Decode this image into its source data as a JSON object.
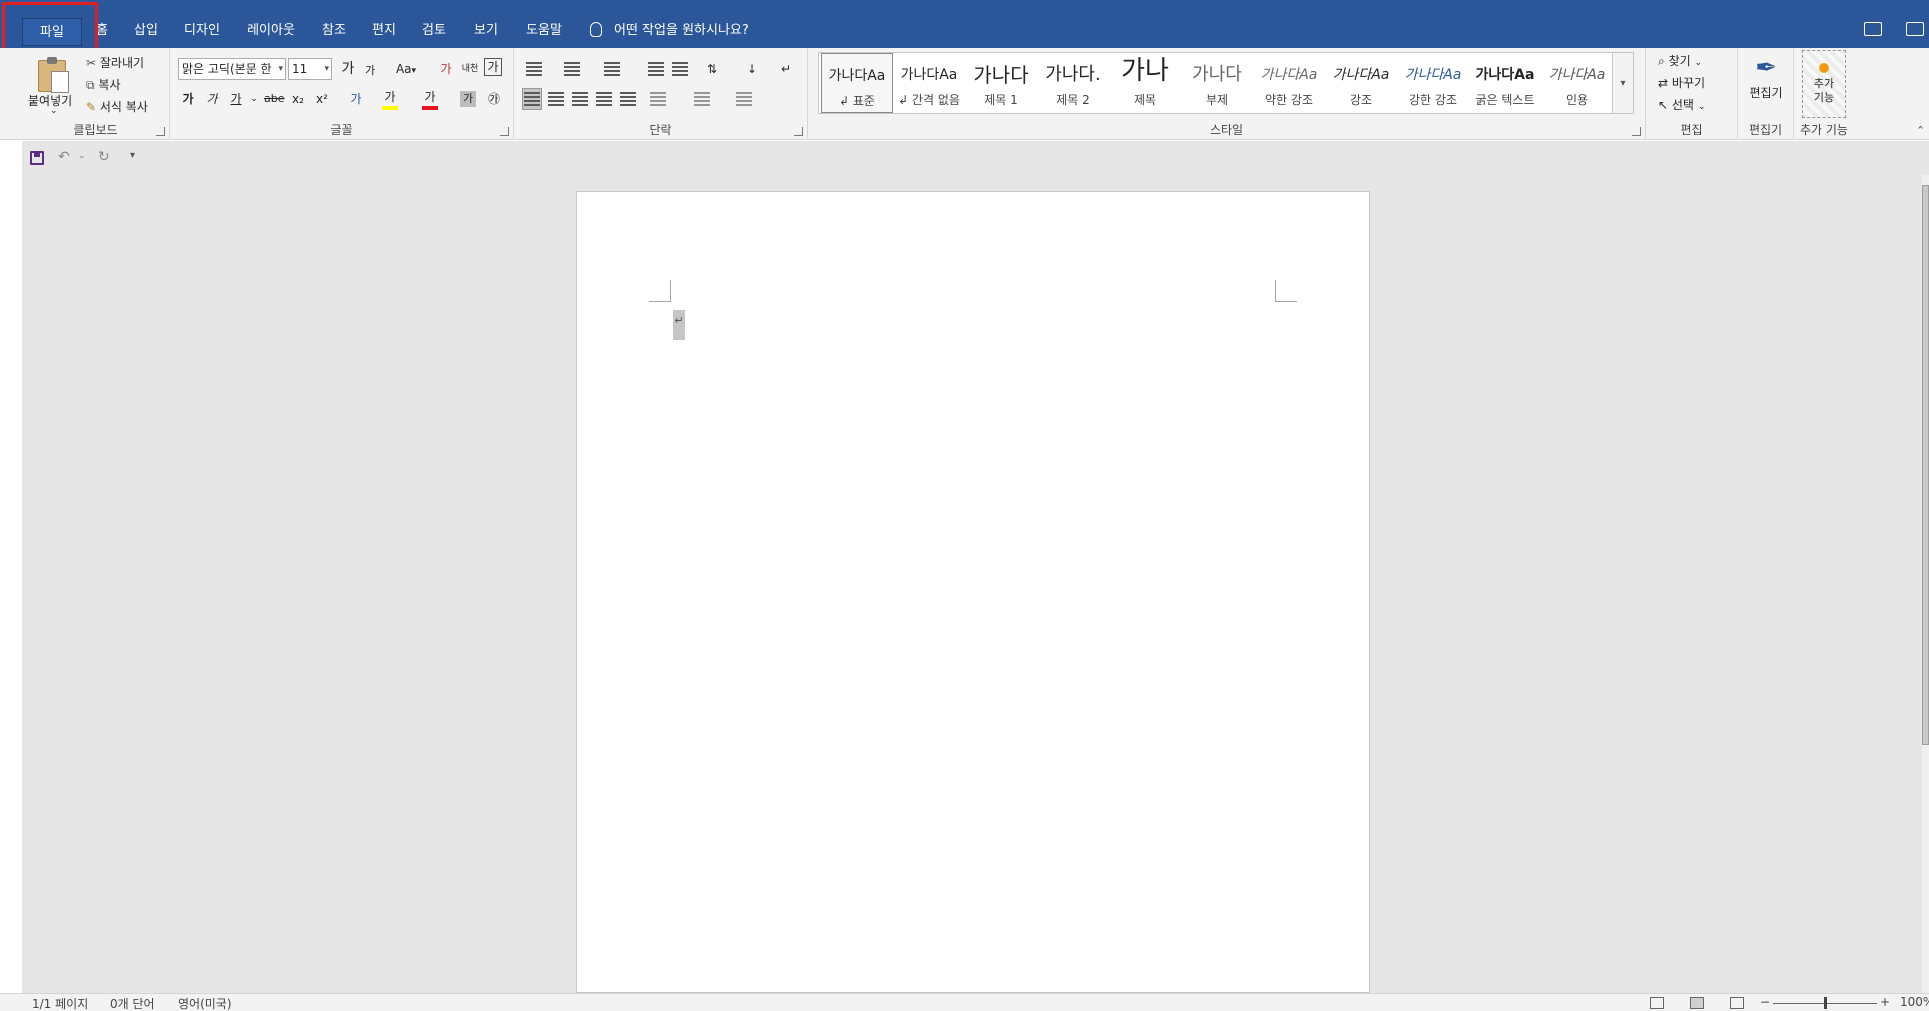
{
  "tabs": {
    "file": "파일",
    "home": "홈",
    "insert": "삽입",
    "design": "디자인",
    "layout": "레이아웃",
    "references": "참조",
    "mailings": "편지",
    "review": "검토",
    "view": "보기",
    "help": "도움말"
  },
  "tell_me": "어떤 작업을 원하시나요?",
  "clipboard": {
    "paste": "붙여넣기",
    "cut": "잘라내기",
    "copy": "복사",
    "format_painter": "서식 복사",
    "label": "클립보드"
  },
  "font": {
    "name": "맑은 고딕(본문 한",
    "size": "11",
    "grow": "가",
    "shrink": "가",
    "case": "Aa",
    "clear": "가",
    "phonetic": "내천",
    "border": "가",
    "bold": "가",
    "italic": "가",
    "underline": "가",
    "strike": "abe",
    "subscript": "x₂",
    "superscript": "x²",
    "effects": "가",
    "highlight": "가",
    "color": "가",
    "shade": "가",
    "enclose": "㉮",
    "label": "글꼴"
  },
  "paragraph": {
    "label": "단락"
  },
  "styles": {
    "label": "스타일",
    "items": [
      {
        "sample": "가나다Aa",
        "name": "↲ 표준"
      },
      {
        "sample": "가나다Aa",
        "name": "↲ 간격 없음"
      },
      {
        "sample": "가나다",
        "name": "제목 1"
      },
      {
        "sample": "가나다.",
        "name": "제목 2"
      },
      {
        "sample": "가나",
        "name": "제목"
      },
      {
        "sample": "가나다",
        "name": "부제"
      },
      {
        "sample": "가나다Aa",
        "name": "약한 강조"
      },
      {
        "sample": "가나다Aa",
        "name": "강조"
      },
      {
        "sample": "가나다Aa",
        "name": "강한 강조"
      },
      {
        "sample": "가나다Aa",
        "name": "굵은 텍스트"
      },
      {
        "sample": "가나다Aa",
        "name": "인용"
      }
    ]
  },
  "editing": {
    "find": "찾기",
    "replace": "바꾸기",
    "select": "선택",
    "label": "편집"
  },
  "editor": {
    "button": "편집기",
    "label": "편집기"
  },
  "addins": {
    "button": "추가 기능",
    "label": "추가 기능"
  },
  "document": {
    "paragraph_mark": "↵"
  },
  "status": {
    "page": "1/1 페이지",
    "words": "0개 단어",
    "language": "영어(미국)",
    "zoom": "100%",
    "zoom_minus": "−",
    "zoom_plus": "+"
  },
  "colors": {
    "accent": "#2b579a",
    "highlight_box": "#e02020",
    "ribbon_bg": "#f3f3f3",
    "canvas_bg": "#e6e6e6"
  }
}
